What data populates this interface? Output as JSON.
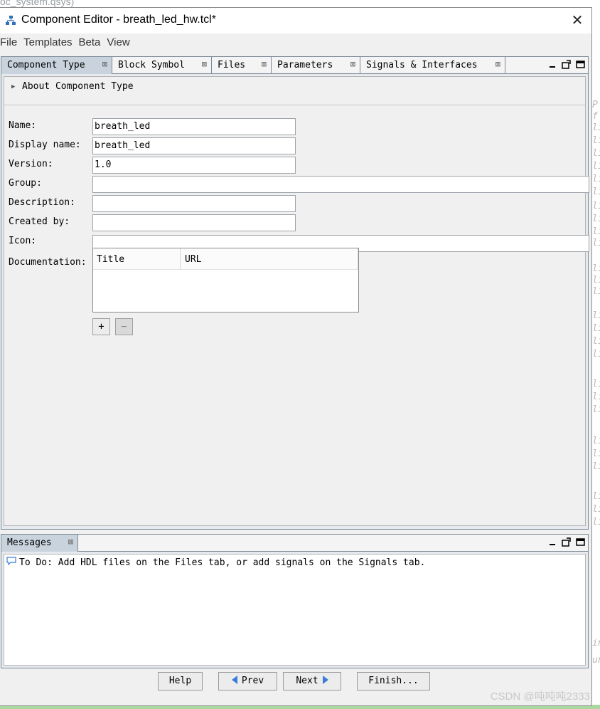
{
  "background": {
    "title_fragment": "oc_system.qsys)",
    "strip_chars": [
      "P",
      "f",
      "li",
      "li",
      "li",
      "li",
      "li",
      "li",
      "li",
      "li",
      "li",
      "li",
      "li",
      "li",
      "li",
      "li",
      "li",
      "li",
      "li",
      "li",
      "li",
      "li",
      "li",
      "li",
      "li",
      "li",
      "li",
      "li",
      "in",
      "un"
    ]
  },
  "window": {
    "title": "Component Editor - breath_led_hw.tcl*",
    "close_label": "✕"
  },
  "menu": [
    "File",
    "Templates",
    "Beta",
    "View"
  ],
  "tabs": [
    {
      "label": "Component Type",
      "close": "⊠",
      "active": true
    },
    {
      "label": "Block Symbol",
      "close": "⊠",
      "active": false
    },
    {
      "label": "Files",
      "close": "⊠",
      "active": false
    },
    {
      "label": "Parameters",
      "close": "⊠",
      "active": false
    },
    {
      "label": "Signals & Interfaces",
      "close": "⊠",
      "active": false
    }
  ],
  "about": {
    "label": "About Component Type"
  },
  "fields": {
    "name": {
      "label": "Name:",
      "value": "breath_led"
    },
    "display_name": {
      "label": "Display name:",
      "value": "breath_led"
    },
    "version": {
      "label": "Version:",
      "value": "1.0"
    },
    "group": {
      "label": "Group:",
      "value": ""
    },
    "description": {
      "label": "Description:",
      "value": ""
    },
    "created_by": {
      "label": "Created by:",
      "value": ""
    },
    "icon": {
      "label": "Icon:",
      "value": ""
    },
    "documentation": {
      "label": "Documentation:"
    }
  },
  "doc_table": {
    "columns": [
      "Title",
      "URL"
    ]
  },
  "doc_buttons": {
    "add": "+",
    "remove": "−"
  },
  "messages": {
    "tab_label": "Messages",
    "tab_close": "⊠",
    "text": "To Do: Add HDL files on the Files tab, or add signals on the Signals tab."
  },
  "buttons": {
    "help": "Help",
    "prev": "Prev",
    "next": "Next",
    "finish": "Finish..."
  },
  "watermark": "CSDN @吨吨吨2333",
  "colors": {
    "active_tab": "#c9d3dd",
    "nav_arrow": "#3a7dd8"
  }
}
